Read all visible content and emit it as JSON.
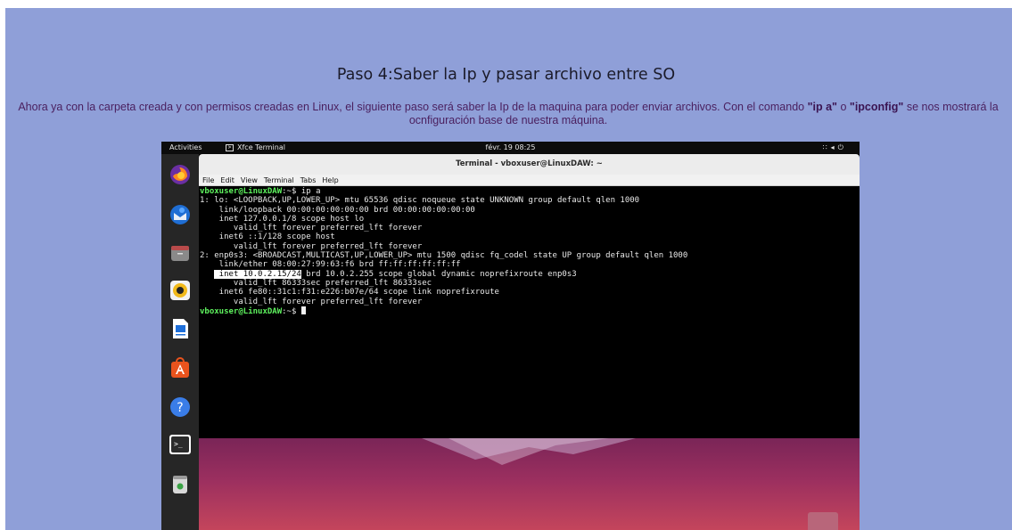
{
  "page": {
    "heading": "Paso 4:Saber la Ip y pasar archivo entre SO",
    "intro": {
      "part1": "Ahora ya con la carpeta creada y con permisos creadas en Linux, el siguiente paso será saber la Ip de la maquina para poder enviar archivos. Con el comando ",
      "cmd1": "\"ip a\"",
      "part2": " o ",
      "cmd2": "\"ipconfig\"",
      "part3": " se nos mostrará la ocnfiguración base de nuestra máquina."
    }
  },
  "topbar": {
    "activities": "Activities",
    "app_name": "Xfce Terminal",
    "clock": "févr. 19 08:25",
    "status_icons": [
      "network-icon",
      "volume-icon",
      "power-icon"
    ]
  },
  "dock": {
    "items": [
      "firefox-icon",
      "thunderbird-icon",
      "files-icon",
      "rhythmbox-icon",
      "writer-icon",
      "software-center-icon",
      "help-icon",
      "terminal-icon",
      "trash-icon"
    ]
  },
  "terminal": {
    "title": "Terminal - vboxuser@LinuxDAW: ~",
    "menu": [
      "File",
      "Edit",
      "View",
      "Terminal",
      "Tabs",
      "Help"
    ],
    "prompt": "vboxuser@LinuxDAW",
    "prompt_suffix": ":~$ ",
    "command": "ip a",
    "lines": [
      "1: lo: <LOOPBACK,UP,LOWER_UP> mtu 65536 qdisc noqueue state UNKNOWN group default qlen 1000",
      "    link/loopback 00:00:00:00:00:00 brd 00:00:00:00:00:00",
      "    inet 127.0.0.1/8 scope host lo",
      "       valid_lft forever preferred_lft forever",
      "    inet6 ::1/128 scope host",
      "       valid_lft forever preferred_lft forever",
      "2: enp0s3: <BROADCAST,MULTICAST,UP,LOWER_UP> mtu 1500 qdisc fq_codel state UP group default qlen 1000",
      "    link/ether 08:00:27:99:63:f6 brd ff:ff:ff:ff:ff:ff"
    ],
    "highlight_lead": "   ",
    "highlight_text": " inet 10.0.2.15/24",
    "highlight_rest": " brd 10.0.2.255 scope global dynamic noprefixroute enp0s3",
    "lines_after": [
      "       valid_lft 86333sec preferred_lft 86333sec",
      "    inet6 fe80::31c1:f31:e226:b07e/64 scope link noprefixroute",
      "       valid_lft forever preferred_lft forever"
    ]
  }
}
